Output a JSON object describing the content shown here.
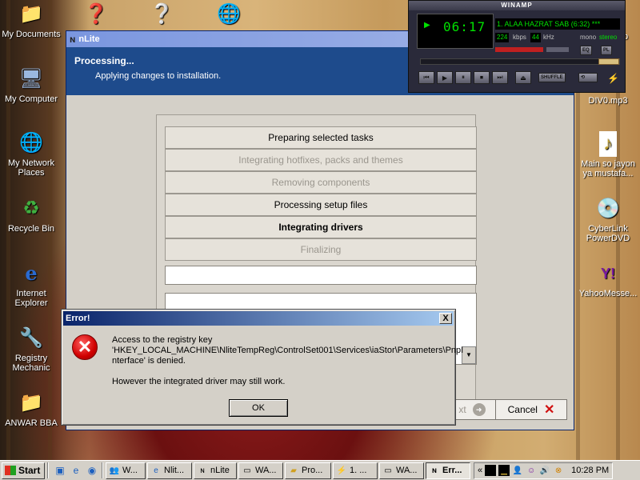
{
  "desktop": {
    "icons_left": [
      {
        "label": "My Documents",
        "icon": "folder-icon"
      },
      {
        "label": "My Computer",
        "icon": "computer-icon"
      },
      {
        "label": "My Network Places",
        "icon": "network-icon"
      },
      {
        "label": "Recycle Bin",
        "icon": "recycle-bin-icon"
      },
      {
        "label": "Internet Explorer",
        "icon": "ie-icon"
      },
      {
        "label": "Registry Mechanic",
        "icon": "registry-icon"
      },
      {
        "label": "ANWAR BBA",
        "icon": "folder-icon"
      }
    ],
    "icons_right": [
      {
        "label": "DIV0.mp3",
        "icon": "mp3-icon"
      },
      {
        "label": "Main so jayon ya mustafa...",
        "icon": "audio-file-icon"
      },
      {
        "label": "CyberLink PowerDVD",
        "icon": "powerdvd-icon"
      },
      {
        "label": "YahooMesse...",
        "icon": "yahoo-icon"
      }
    ],
    "partial_label_right": "Pro"
  },
  "nlite": {
    "title": "nLite",
    "header_title": "Processing...",
    "header_subtitle": "Applying changes to installation.",
    "tasks": [
      {
        "label": "Preparing selected tasks",
        "state": "done"
      },
      {
        "label": "Integrating hotfixes, packs and themes",
        "state": "skipped"
      },
      {
        "label": "Removing components",
        "state": "skipped"
      },
      {
        "label": "Processing setup files",
        "state": "done"
      },
      {
        "label": "Integrating drivers",
        "state": "current"
      },
      {
        "label": "Finalizing",
        "state": "pending"
      }
    ],
    "next_label": "xt",
    "cancel_label": "Cancel"
  },
  "winamp": {
    "title": "WINAMP",
    "time": "06:17",
    "song": "1. ALAA HAZRAT SAB (6:32) ***",
    "kbps": "224",
    "kbps_label": "kbps",
    "khz": "44",
    "khz_label": "kHz",
    "mono_label": "mono",
    "stereo_label": "stereo",
    "eq_label": "EQ",
    "pl_label": "PL",
    "shuffle_label": "SHUFFLE",
    "seek_position": 0.9
  },
  "error_dialog": {
    "title": "Error!",
    "close_label": "X",
    "line1": "Access to the registry key",
    "line2": "'HKEY_LOCAL_MACHINE\\NliteTempReg\\ControlSet001\\Services\\iaStor\\Parameters\\PnpI",
    "line3": "nterface' is denied.",
    "line4": "However the integrated driver may still work.",
    "ok_label": "OK"
  },
  "taskbar": {
    "start_label": "Start",
    "buttons": [
      {
        "label": "W...",
        "icon": "windows-explorer-icon"
      },
      {
        "label": "Nlit...",
        "icon": "ie-icon"
      },
      {
        "label": "nLite",
        "icon": "nlite-icon"
      },
      {
        "label": "WA...",
        "icon": "drive-icon"
      },
      {
        "label": "Pro...",
        "icon": "folder-icon"
      },
      {
        "label": "1. ...",
        "icon": "winamp-icon"
      },
      {
        "label": "WA...",
        "icon": "drive-icon"
      },
      {
        "label": "Err...",
        "icon": "nlite-icon",
        "active": true
      }
    ],
    "tray_arrow": "«",
    "clock": "10:28 PM"
  }
}
